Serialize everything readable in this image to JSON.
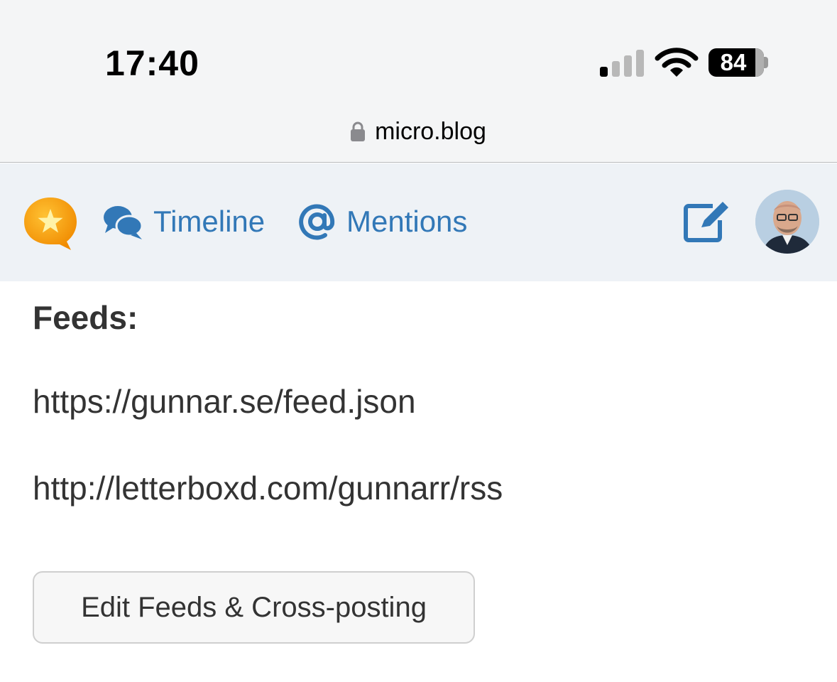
{
  "status_bar": {
    "time": "17:40",
    "battery_level": "84",
    "signal_icon": "cellular-signal-icon",
    "wifi_icon": "wifi-icon"
  },
  "browser": {
    "url": "micro.blog",
    "lock_icon": "lock-icon"
  },
  "nav": {
    "logo_icon": "microblog-star-logo-icon",
    "timeline_label": "Timeline",
    "timeline_icon": "chat-bubbles-icon",
    "mentions_label": "Mentions",
    "mentions_icon": "at-sign-icon",
    "compose_icon": "compose-icon",
    "avatar": "user-avatar",
    "accent_color": "#3278b7"
  },
  "content": {
    "heading": "Feeds:",
    "feeds": [
      "https://gunnar.se/feed.json",
      "http://letterboxd.com/gunnarr/rss"
    ],
    "edit_button_label": "Edit Feeds & Cross-posting"
  }
}
